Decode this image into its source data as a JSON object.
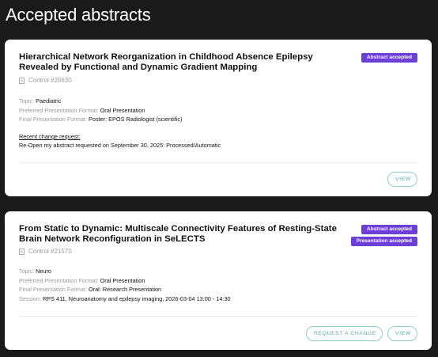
{
  "page": {
    "title": "Accepted abstracts"
  },
  "abstracts": [
    {
      "title": "Hierarchical Network Reorganization in Childhood Absence Epilepsy Revealed by Functional and Dynamic Gradient Mapping",
      "control": "Control #20630",
      "badges": [
        "Abstract accepted"
      ],
      "topic_label": "Topic:",
      "topic": "Paediatric",
      "preferred_label": "Preferred Presentation Format:",
      "preferred": "Oral Presentation",
      "final_label": "Final Presentation Format:",
      "final": "Poster: EPOS Radiologist (scientific)",
      "change_header": "Recent change request:",
      "change_text": "Re-Open my abstract requested on September 30, 2025: Processed/Automatic",
      "buttons": {
        "view": "VIEW"
      }
    },
    {
      "title": "From Static to Dynamic: Multiscale Connectivity Features of Resting-State Brain Network Reconfiguration in SeLECTS",
      "control": "Control #21570",
      "badges": [
        "Abstract accepted",
        "Presentation accepted"
      ],
      "topic_label": "Topic:",
      "topic": "Neuro",
      "preferred_label": "Preferred Presentation Format:",
      "preferred": "Oral Presentation",
      "final_label": "Final Presentation Format:",
      "final": "Oral: Research Presentation",
      "session_label": "Session:",
      "session": "RPS 411, Neuroanatomy and epilepsy imaging, 2026-03-04 13:00 - 14:30",
      "buttons": {
        "request_change": "REQUEST A CHANGE",
        "view": "VIEW"
      }
    }
  ],
  "colors": {
    "background": "#1a1a1a",
    "card": "#ffffff",
    "badge": "#6b3fd8",
    "button_accent": "#5aaba0"
  },
  "icons": {
    "control": "document-icon"
  }
}
